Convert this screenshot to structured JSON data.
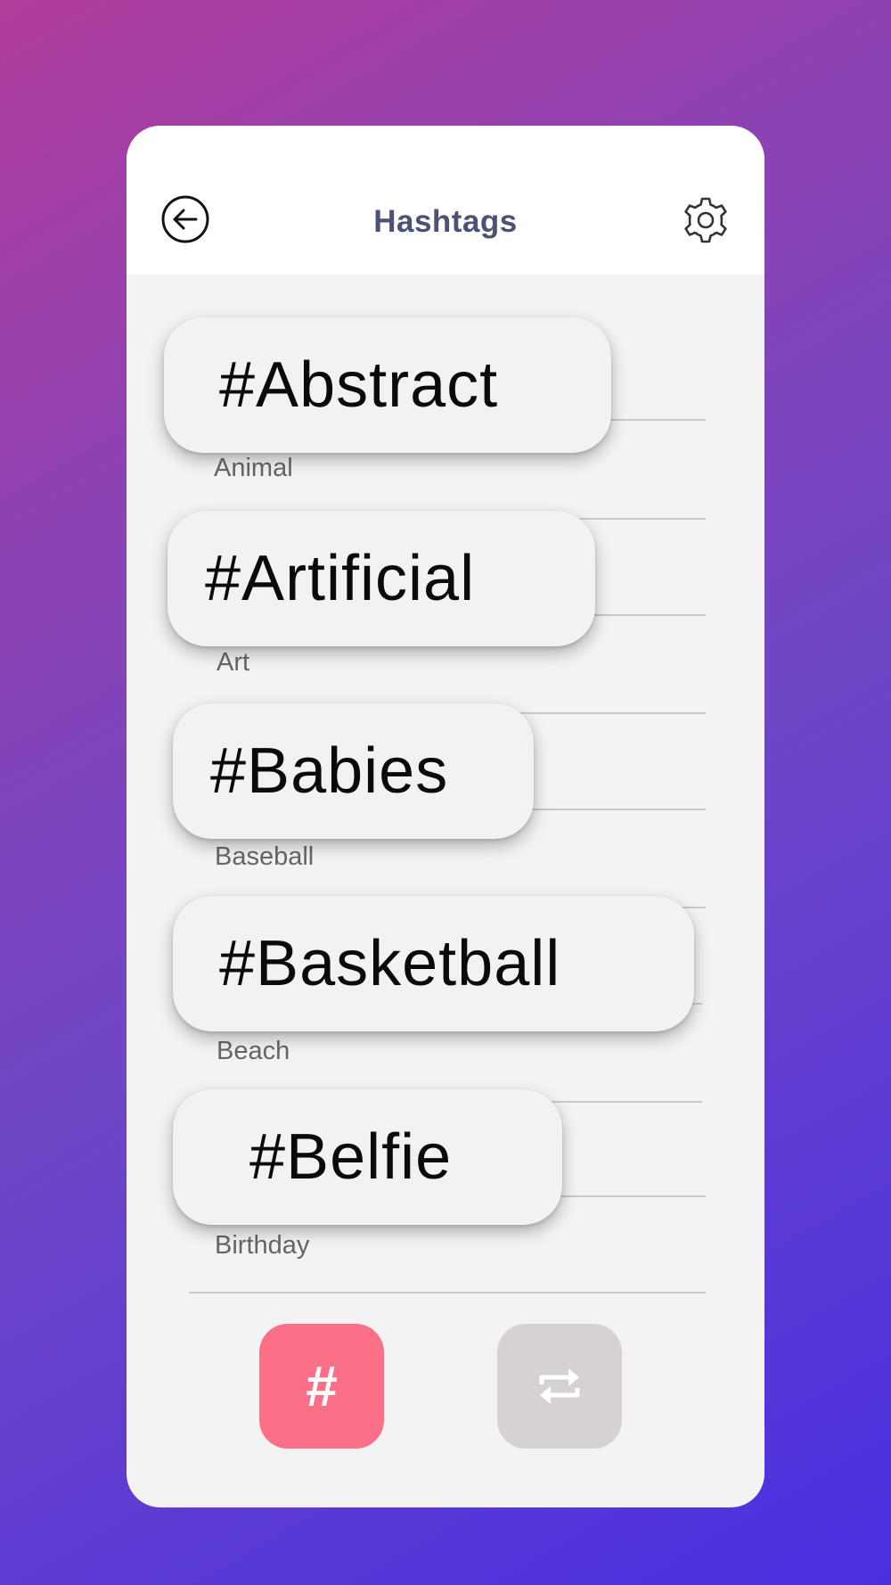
{
  "header": {
    "title": "Hashtags",
    "back_icon": "back-arrow-circle-icon",
    "settings_icon": "gear-icon"
  },
  "list": {
    "rows": [
      {
        "label": "Animal"
      },
      {
        "label": "Art"
      },
      {
        "label": "Baseball"
      },
      {
        "label": "Beach"
      },
      {
        "label": "Birthday"
      }
    ]
  },
  "chips": [
    {
      "text": "#Abstract"
    },
    {
      "text": "#Artificial"
    },
    {
      "text": "#Babies"
    },
    {
      "text": "#Basketball"
    },
    {
      "text": "#Belfie"
    }
  ],
  "bottom_bar": {
    "hashtag_button_glyph": "#",
    "hashtag_button_icon": "hashtag-icon",
    "swap_button_icon": "repeat-swap-icon"
  },
  "colors": {
    "accent": "#fb7086",
    "title": "#4a5275",
    "inactive_button": "#d6d2d3"
  }
}
